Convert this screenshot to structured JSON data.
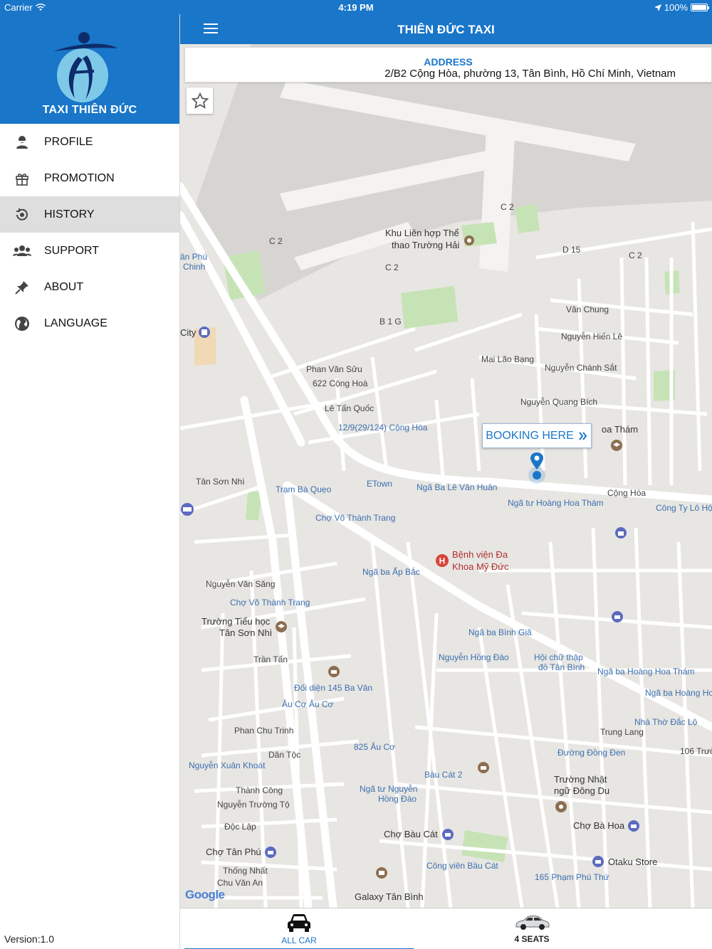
{
  "status_bar": {
    "carrier": "Carrier",
    "time": "4:19 PM",
    "battery": "100%"
  },
  "app": {
    "title": "THIÊN ĐỨC TAXI",
    "brand": "TAXI THIÊN ĐỨC",
    "version": "Version:1.0"
  },
  "menu": [
    {
      "label": "PROFILE",
      "icon": "user-icon"
    },
    {
      "label": "PROMOTION",
      "icon": "gift-icon"
    },
    {
      "label": "HISTORY",
      "icon": "history-icon",
      "active": true
    },
    {
      "label": "SUPPORT",
      "icon": "group-icon"
    },
    {
      "label": "ABOUT",
      "icon": "pin-icon"
    },
    {
      "label": "LANGUAGE",
      "icon": "globe-icon"
    }
  ],
  "address": {
    "label": "ADDRESS",
    "value": "2/B2 Cộng Hòa, phường 13, Tân Bình, Hồ Chí Minh, Vietnam"
  },
  "map": {
    "booking_label": "BOOKING HERE",
    "attribution": "Google",
    "labels": {
      "khu": "Khu Liên hợp Thể",
      "khu2": "thao Trường Hải",
      "vanchung": "Văn Chung",
      "nguyenhienle": "Nguyễn Hiến Lê",
      "mailaobang": "Mai Lão Bạng",
      "nguyenchanhsat": "Nguyễn Chánh Sắt",
      "nguyenquangbich": "Nguyễn Quang Bích",
      "phanvansuu": "Phan Văn Sửu",
      "conghoa622": "622 Cộng Hoà",
      "letanquoc": "Lê Tấn Quốc",
      "conghoa12": "12/9(29/124) Cộng Hòa",
      "tramquacbaqueo": "Trạm Bà Quẹo",
      "etown": "ETown",
      "ngabalevanhuan": "Ngã Ba Lê Văn Huân",
      "conghoa": "Cộng Hòa",
      "ngatuhoanghoatham": "Ngã tư Hoàng Hoa Thám",
      "congtylohoi": "Công Ty Lô Hội",
      "chovothanhtrang": "Chợ Võ Thành Trang",
      "benhvien1": "Bệnh viện Đa",
      "benhvien2": "Khoa Mỹ Đức",
      "truongchinh": "Trường Chinh",
      "ngabaapbac": "Ngã ba Ấp Bắc",
      "tansonnhi": "Tân Sơn Nhì",
      "nguyenvansang": "Nguyễn Văn Săng",
      "chovothanhtrang2": "Chợ Võ Thành Trang",
      "truongtieuhoc1": "Trường Tiểu học",
      "truongtieuhoc2": "Tân Sơn Nhì",
      "trantan": "Trần Tấn",
      "doidien145": "Đối diện 145 Ba Vân",
      "aucoauco": "Âu Cơ Âu Cơ",
      "phanchutrinh": "Phan Chu Trinh",
      "dantoc": "Dân Tộc",
      "nguyenxuankhoat": "Nguyễn Xuân Khoát",
      "thanhcong": "Thành Công",
      "nguyentruongto": "Nguyễn Trường Tộ",
      "doclap": "Độc Lập",
      "chotanphu": "Chợ Tân Phú",
      "thongnhat": "Thống Nhất",
      "chuvanan": "Chu Văn An",
      "au825": "825 Âu Cơ",
      "ngatunguyen1": "Ngã tư Nguyễn",
      "ngatunguyen2": "Hồng Đào",
      "chobaucat": "Chợ Bàu Cát",
      "congvienbaucat": "Công viên Bầu Cát",
      "galaxy": "Galaxy Tân Bình",
      "ngababinhgia": "Ngã ba Bình Giã",
      "nguyenhongdao": "Nguyễn Hồng Đào",
      "hoichuthap1": "Hội chữ thập",
      "hoichuthap2": "đỏ Tân Bình",
      "ngabahoanghoatham": "Ngã ba Hoàng Hoa Thám",
      "ngabahoangho": "Ngã ba Hoàng Ho",
      "nhatho": "Nhà Thờ Đắc Lộ",
      "duongdongden": "Đường Đồng Đen",
      "truongnhat1": "Trường Nhật",
      "truongnhat2": "ngữ Đông Du",
      "chobahoa": "Chợ Bà Hoa",
      "otaku": "Otaku Store",
      "phamphuthu": "165 Phạm Phú Thứ",
      "baucat2": "Bàu Cát 2",
      "trunglang": "Trung Lang",
      "trucs106": "106 Trườ",
      "c2a": "C 2",
      "c2b": "C 2",
      "c2c": "C 2",
      "c2d": "C 2",
      "d15": "D 15",
      "b1g": "B 1 G",
      "tham": "oa Thám",
      "city": "City",
      "phu": "ân Phú",
      "chinh": "Chinh"
    }
  },
  "tabs": [
    {
      "label": "ALL CAR",
      "icon": "car-icon",
      "selected": true
    },
    {
      "label": "4 SEATS",
      "icon": "sedan-icon",
      "selected": false
    }
  ],
  "colors": {
    "primary": "#1976c9",
    "active_row": "#dedede"
  }
}
